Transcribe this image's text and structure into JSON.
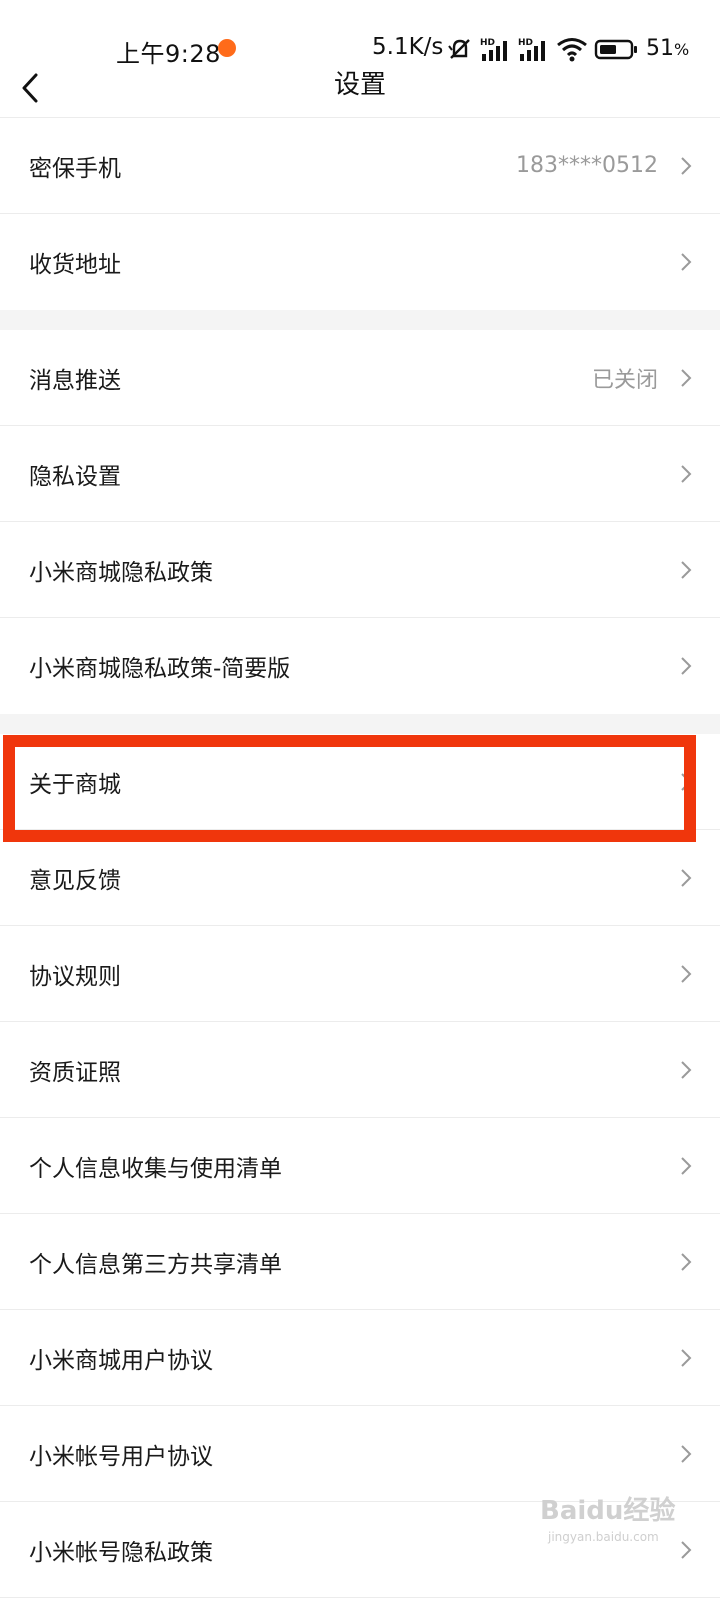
{
  "status_bar": {
    "time": "上午9:28",
    "network_speed": "5.1K/s",
    "battery_percent": "51",
    "battery_unit": "%",
    "accent_dot_color": "#ff6b1a"
  },
  "header": {
    "title": "设置",
    "back_icon": "chevron-left-icon"
  },
  "sections": [
    {
      "items": [
        {
          "label": "密保手机",
          "value": "183****0512"
        },
        {
          "label": "收货地址",
          "value": ""
        }
      ]
    },
    {
      "items": [
        {
          "label": "消息推送",
          "value": "已关闭"
        },
        {
          "label": "隐私设置",
          "value": ""
        },
        {
          "label": "小米商城隐私政策",
          "value": ""
        },
        {
          "label": "小米商城隐私政策-简要版",
          "value": ""
        }
      ]
    },
    {
      "items": [
        {
          "label": "关于商城",
          "value": ""
        },
        {
          "label": "意见反馈",
          "value": ""
        },
        {
          "label": "协议规则",
          "value": ""
        },
        {
          "label": "资质证照",
          "value": ""
        },
        {
          "label": "个人信息收集与使用清单",
          "value": ""
        },
        {
          "label": "个人信息第三方共享清单",
          "value": ""
        },
        {
          "label": "小米商城用户协议",
          "value": ""
        },
        {
          "label": "小米帐号用户协议",
          "value": ""
        },
        {
          "label": "小米帐号隐私政策",
          "value": ""
        }
      ]
    }
  ],
  "highlight": {
    "target": "关于商城",
    "color": "#f0360c"
  },
  "watermark": {
    "text": "Baidu经验",
    "sub": "jingyan.baidu.com"
  }
}
